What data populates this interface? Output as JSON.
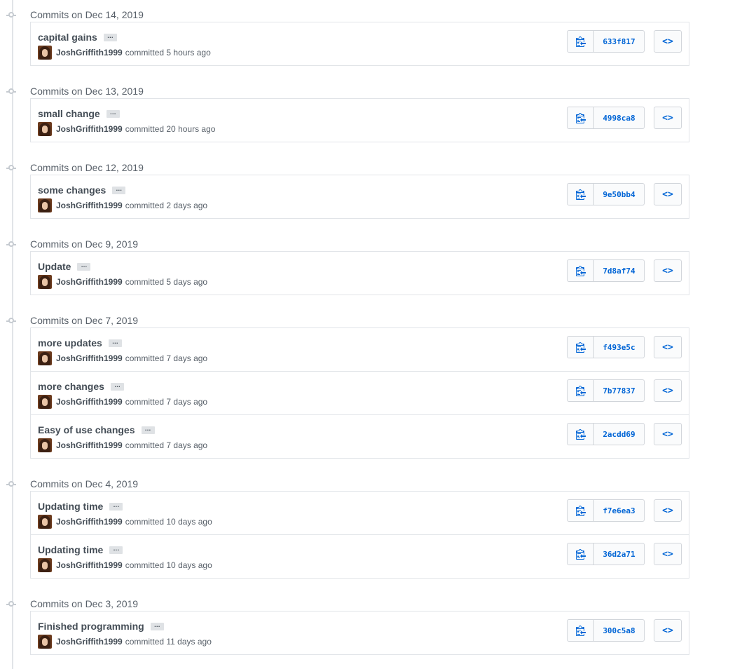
{
  "groups": [
    {
      "title": "Commits on Dec 14, 2019",
      "commits": [
        {
          "message": "capital gains",
          "author": "JoshGriffith1999",
          "time": "committed 5 hours ago",
          "sha": "633f817"
        }
      ]
    },
    {
      "title": "Commits on Dec 13, 2019",
      "commits": [
        {
          "message": "small change",
          "author": "JoshGriffith1999",
          "time": "committed 20 hours ago",
          "sha": "4998ca8"
        }
      ]
    },
    {
      "title": "Commits on Dec 12, 2019",
      "commits": [
        {
          "message": "some changes",
          "author": "JoshGriffith1999",
          "time": "committed 2 days ago",
          "sha": "9e50bb4"
        }
      ]
    },
    {
      "title": "Commits on Dec 9, 2019",
      "commits": [
        {
          "message": "Update",
          "author": "JoshGriffith1999",
          "time": "committed 5 days ago",
          "sha": "7d8af74"
        }
      ]
    },
    {
      "title": "Commits on Dec 7, 2019",
      "commits": [
        {
          "message": "more updates",
          "author": "JoshGriffith1999",
          "time": "committed 7 days ago",
          "sha": "f493e5c"
        },
        {
          "message": "more changes",
          "author": "JoshGriffith1999",
          "time": "committed 7 days ago",
          "sha": "7b77837"
        },
        {
          "message": "Easy of use changes",
          "author": "JoshGriffith1999",
          "time": "committed 7 days ago",
          "sha": "2acdd69"
        }
      ]
    },
    {
      "title": "Commits on Dec 4, 2019",
      "commits": [
        {
          "message": "Updating time",
          "author": "JoshGriffith1999",
          "time": "committed 10 days ago",
          "sha": "f7e6ea3"
        },
        {
          "message": "Updating time",
          "author": "JoshGriffith1999",
          "time": "committed 10 days ago",
          "sha": "36d2a71"
        }
      ]
    },
    {
      "title": "Commits on Dec 3, 2019",
      "commits": [
        {
          "message": "Finished programming",
          "author": "JoshGriffith1999",
          "time": "committed 11 days ago",
          "sha": "300c5a8"
        }
      ]
    }
  ],
  "labels": {
    "ellipsis": "…",
    "browse": "<>"
  },
  "icons": {
    "copy": "clipboard-icon",
    "browse": "code-icon",
    "node": "commit-node-icon"
  },
  "colors": {
    "link": "#0366d6",
    "border": "#e1e4e8",
    "muted": "#586069"
  }
}
